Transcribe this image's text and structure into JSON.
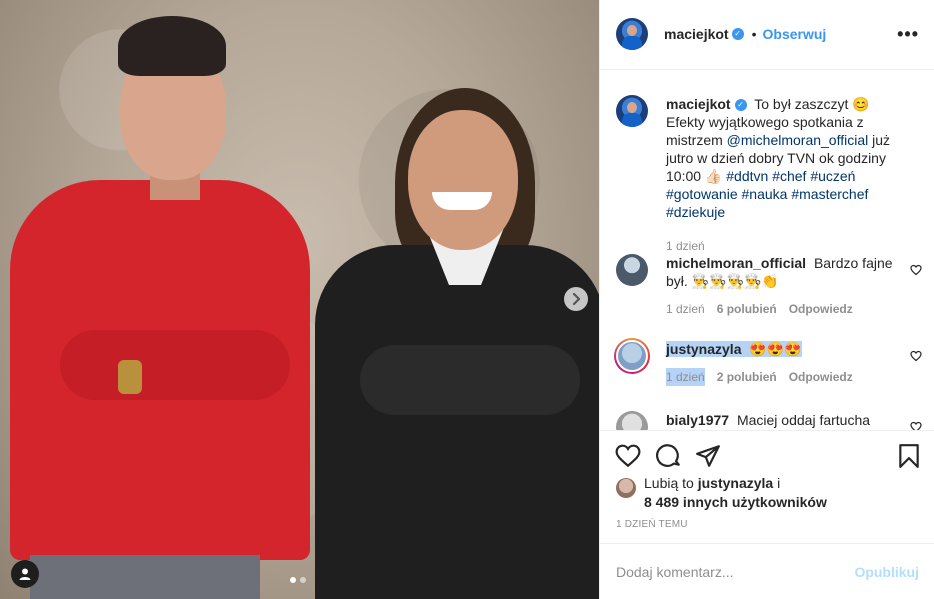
{
  "post": {
    "username": "maciejkot",
    "follow_label": "Obserwuj",
    "separator": "•",
    "more_label": "•••",
    "images_count": 2,
    "active_image": 1
  },
  "caption": {
    "username": "maciejkot",
    "text_1": "To był zaszczyt 😊 Efekty wyjątkowego spotkania z mistrzem",
    "mention": "@michelmoran_official",
    "text_2": " już jutro w dzień dobry TVN ok godziny 10:00 👍🏻",
    "hashtags": [
      "#ddtvn",
      "#chef",
      "#uczeń",
      "#gotowanie",
      "#nauka",
      "#masterchef",
      "#dziekuje"
    ],
    "time": "1 dzień"
  },
  "comments": [
    {
      "username": "michelmoran_official",
      "text": "Bardzo fajne był. 👨‍🍳👨‍🍳👨‍🍳👨‍🍳👏",
      "time": "1 dzień",
      "likes": "6 polubień",
      "reply": "Odpowiedz"
    },
    {
      "username": "justynazyla",
      "text": "😍😍😍",
      "time": "1 dzień",
      "likes": "2 polubień",
      "reply": "Odpowiedz"
    },
    {
      "username": "bialy1977",
      "text": "Maciej oddaj fartucha"
    }
  ],
  "likes": {
    "prefix": "Lubią to",
    "user": "justynazyla",
    "conj": "i",
    "others": "8 489 innych użytkowników"
  },
  "date": "1 dzień temu",
  "add_comment": {
    "placeholder": "Dodaj komentarz...",
    "publish_label": "Opublikuj"
  },
  "icons": {
    "like": "heart-icon",
    "comment": "comment-icon",
    "share": "share-icon",
    "save": "bookmark-icon"
  },
  "colors": {
    "link": "#003569",
    "accent": "#3897f0",
    "muted": "#8e8e8e",
    "publish_disabled": "#b2dffc",
    "selection": "#b4d3f6"
  }
}
